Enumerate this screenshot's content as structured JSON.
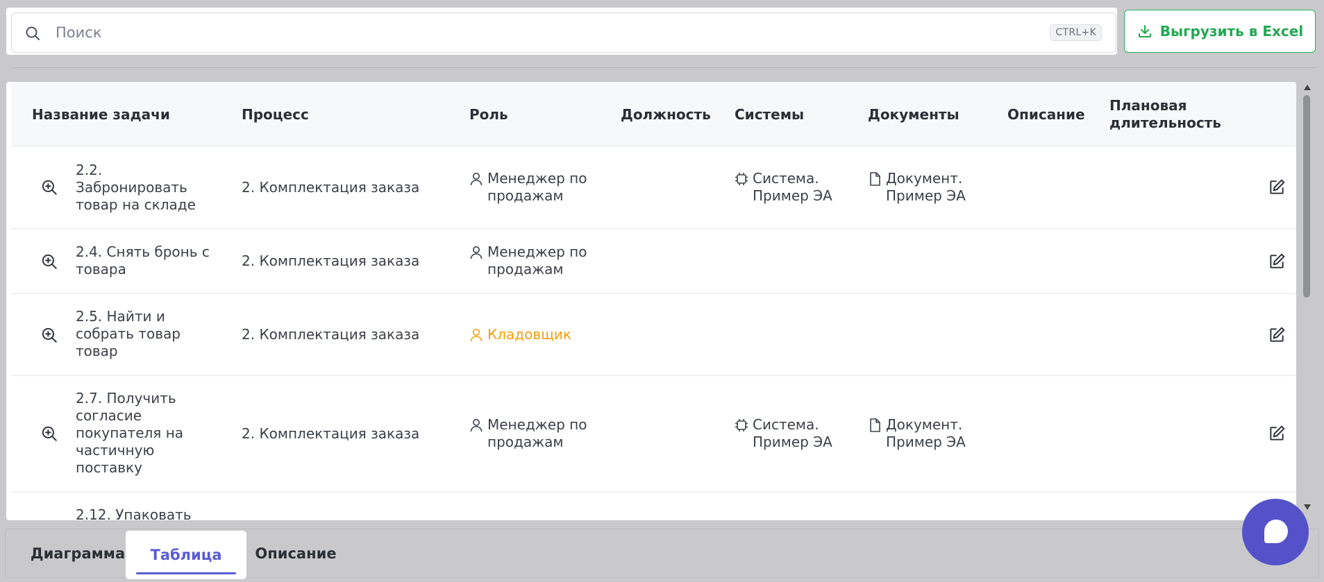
{
  "search": {
    "placeholder": "Поиск",
    "shortcut": "CTRL+K"
  },
  "toolbar": {
    "export_label": "Выгрузить в Excel"
  },
  "table": {
    "columns": {
      "name": "Название задачи",
      "process": "Процесс",
      "role": "Роль",
      "position": "Должность",
      "systems": "Системы",
      "documents": "Документы",
      "description": "Описание",
      "duration_line1": "Плановая",
      "duration_line2": "длительность"
    },
    "rows": [
      {
        "name": [
          "2.2.",
          "Забронировать",
          "товар на складе"
        ],
        "process": "2. Комплектация заказа",
        "role": [
          "Менеджер по",
          "продажам"
        ],
        "system": [
          "Система.",
          "Пример ЭА"
        ],
        "document": [
          "Документ.",
          "Пример ЭА"
        ]
      },
      {
        "name": [
          "2.4. Снять бронь с",
          "товара"
        ],
        "process": "2. Комплектация заказа",
        "role": [
          "Менеджер по",
          "продажам"
        ]
      },
      {
        "name": [
          "2.5. Найти и",
          "собрать товар",
          "товар"
        ],
        "process": "2. Комплектация заказа",
        "role": [
          "Кладовщик"
        ],
        "role_color": "#f59e0b"
      },
      {
        "name": [
          "2.7. Получить",
          "согласие",
          "покупателя на",
          "частичную",
          "поставку"
        ],
        "process": "2. Комплектация заказа",
        "role": [
          "Менеджер по",
          "продажам"
        ],
        "system": [
          "Система.",
          "Пример ЭА"
        ],
        "document": [
          "Документ.",
          "Пример ЭА"
        ]
      },
      {
        "name": [
          "2.12. Упаковать"
        ]
      }
    ]
  },
  "tabs": [
    {
      "label": "Диаграмма"
    },
    {
      "label": "Таблица",
      "active": true
    },
    {
      "label": "Описание"
    }
  ],
  "colors": {
    "accent": "#5b5bd6",
    "export": "#22a852",
    "warning": "#f59e0b",
    "fab": "#5552c9"
  },
  "icons": [
    "search-icon",
    "download-icon",
    "zoom-in-icon",
    "user-icon",
    "chip-icon",
    "file-icon",
    "edit-icon",
    "chat-icon"
  ]
}
